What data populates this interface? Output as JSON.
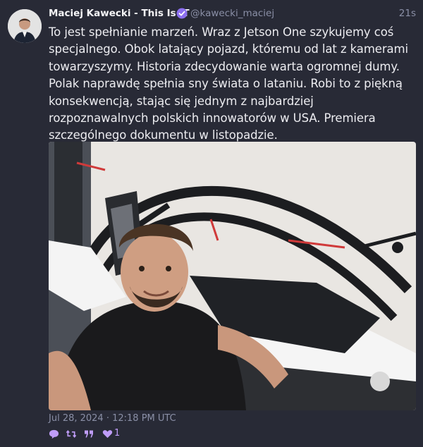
{
  "tweet": {
    "author_name": "Maciej Kawecki - This Is IT",
    "handle": "@kawecki_maciej",
    "relative_time": "21s",
    "text": "To jest spełnianie marzeń. Wraz z Jetson One szykujemy coś\nspecjalnego. Obok latający pojazd, któremu od lat z kamerami\ntowarzyszymy. Historia zdecydowanie warta ogromnej dumy.\nPolak naprawdę spełnia sny świata o lataniu. Robi to z piękną\nkonsekwencją, stając się jednym z najbardziej\nrozpoznawalnych polskich innowatorów w USA. Premiera\nszczególnego dokumentu w listopadzie.",
    "timestamp": "Jul 28, 2024 · 12:18 PM UTC",
    "like_count": "1"
  },
  "icons": {
    "verified": "verified-badge-icon",
    "reply": "reply-icon",
    "retweet": "retweet-icon",
    "quote": "quote-icon",
    "like": "heart-icon"
  },
  "colors": {
    "background": "#282a36",
    "accent": "#bf9cf8",
    "muted": "#8a8fa6",
    "verified": "#8c6ff0"
  }
}
